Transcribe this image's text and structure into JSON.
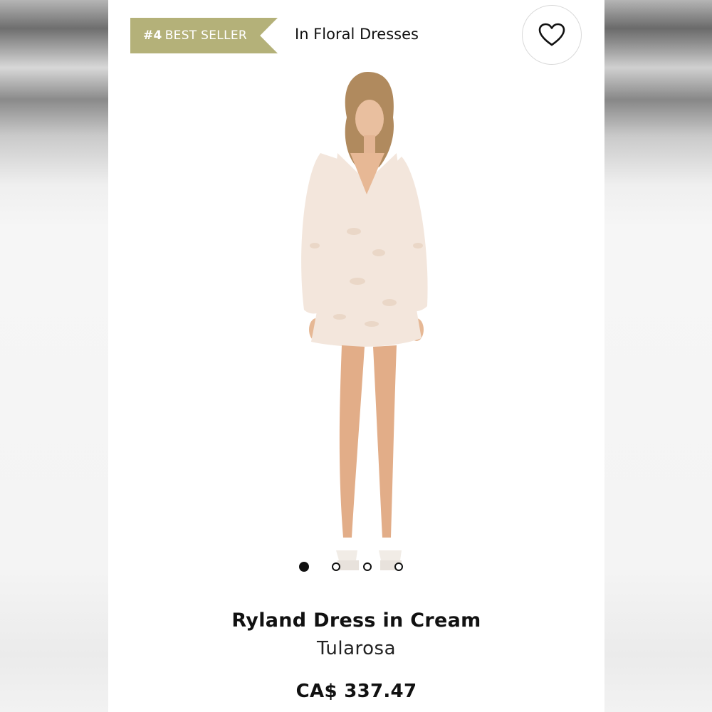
{
  "badge": {
    "rank": "#4",
    "label": "BEST SELLER"
  },
  "category": {
    "label": "In Floral Dresses"
  },
  "favorite": {
    "icon": "heart-icon"
  },
  "gallery": {
    "image_count": 4,
    "active_index": 0
  },
  "product": {
    "name": "Ryland Dress in Cream",
    "brand": "Tularosa",
    "price": "CA$ 337.47"
  },
  "colors": {
    "badge": "#b4b179",
    "dress": "#f3e6dc"
  }
}
